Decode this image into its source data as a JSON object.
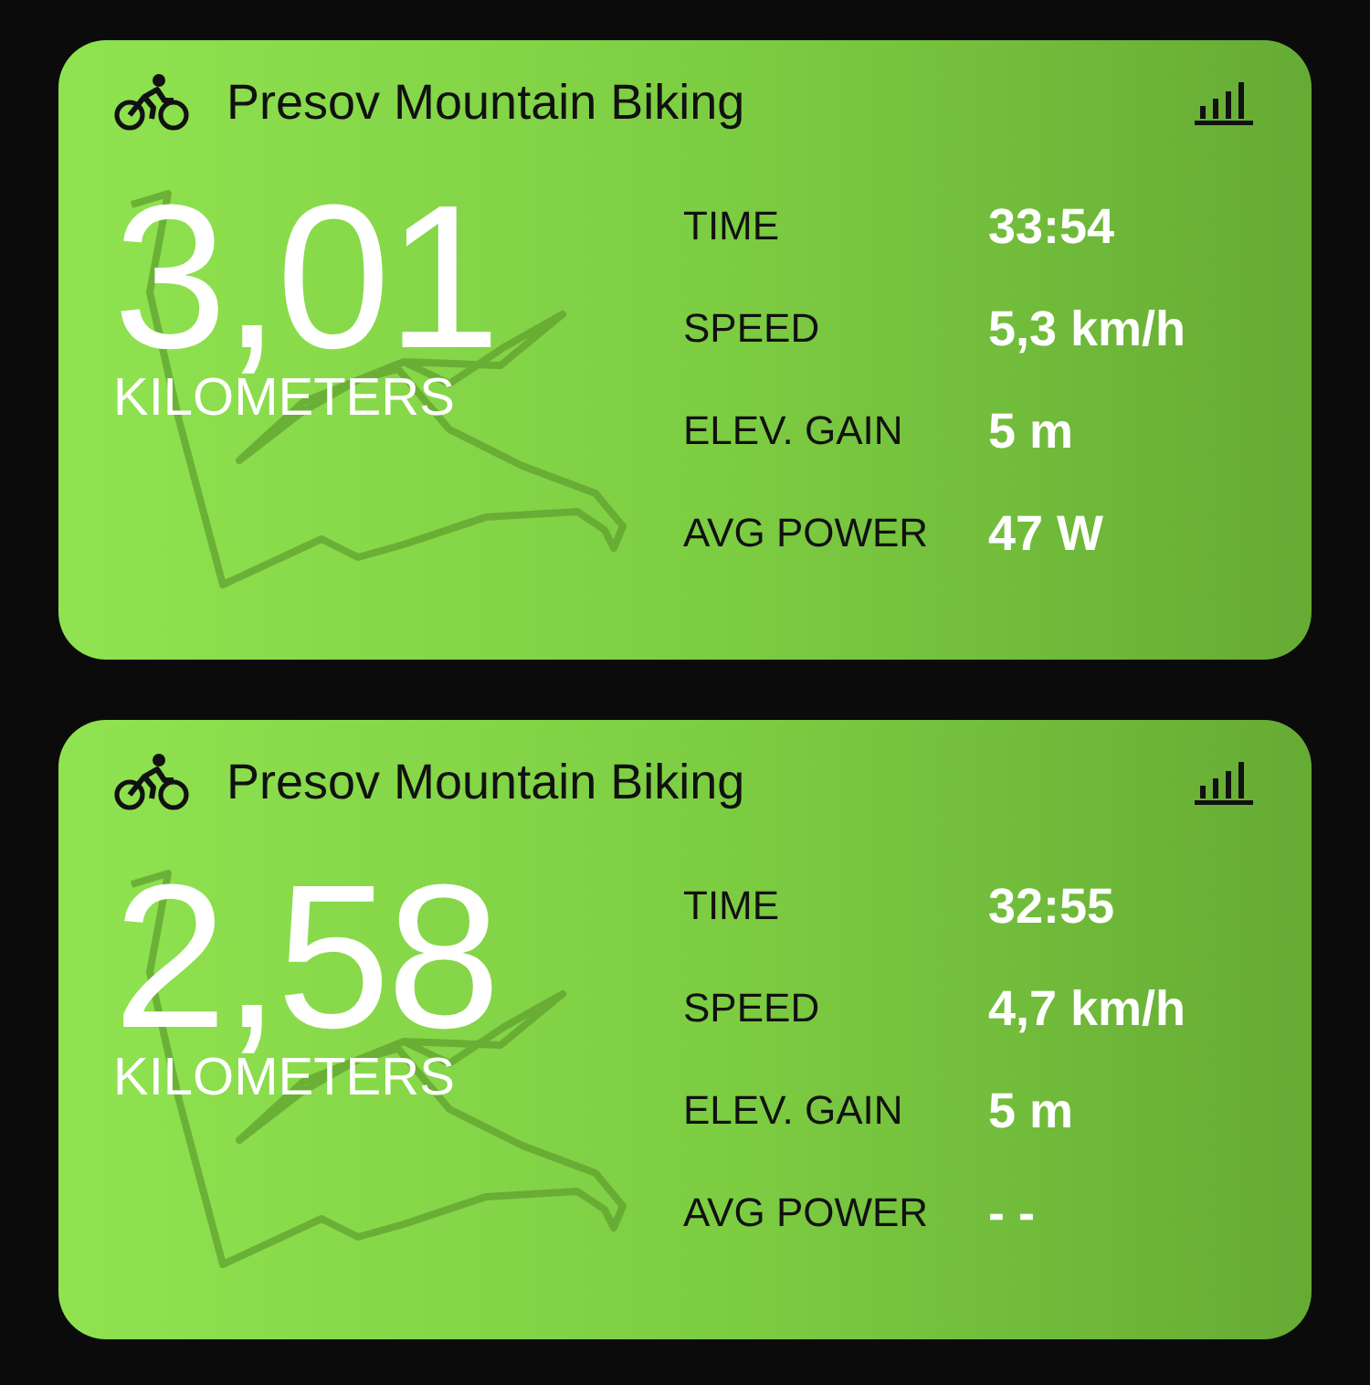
{
  "activities": [
    {
      "title": "Presov Mountain Biking",
      "distance": "3,01",
      "unit": "KILOMETERS",
      "stats": [
        {
          "label": "TIME",
          "value": "33:54"
        },
        {
          "label": "SPEED",
          "value": "5,3 km/h"
        },
        {
          "label": "ELEV. GAIN",
          "value": "5 m"
        },
        {
          "label": "AVG POWER",
          "value": "47 W"
        }
      ]
    },
    {
      "title": "Presov Mountain Biking",
      "distance": "2,58",
      "unit": "KILOMETERS",
      "stats": [
        {
          "label": "TIME",
          "value": "32:55"
        },
        {
          "label": "SPEED",
          "value": "4,7 km/h"
        },
        {
          "label": "ELEV. GAIN",
          "value": "5 m"
        },
        {
          "label": "AVG POWER",
          "value": "- -"
        }
      ]
    }
  ]
}
